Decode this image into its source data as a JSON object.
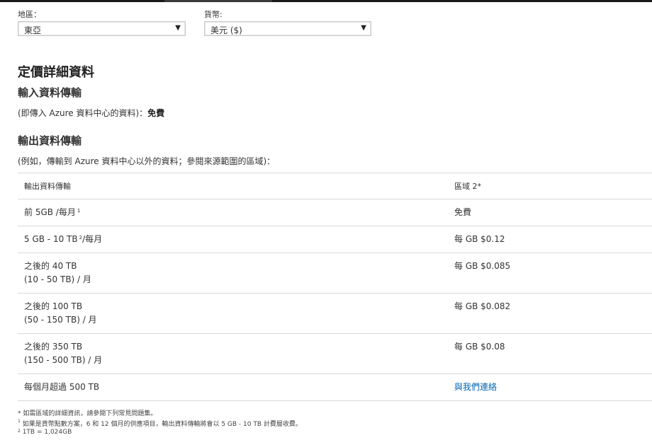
{
  "filters": {
    "region_label": "地區：",
    "region_value": "東亞",
    "currency_label": "貨幣:",
    "currency_value": "美元 ($)"
  },
  "details": {
    "heading": "定價詳細資料",
    "ingress": {
      "heading": "輸入資料傳輸",
      "note_prefix": "(即傳入 Azure 資料中心的資料)：",
      "note_value": "免費"
    },
    "egress": {
      "heading": "輸出資料傳輸",
      "note": "(例如，傳輸到 Azure 資料中心以外的資料；參閱來源範圍的區域)："
    }
  },
  "table": {
    "headers": [
      "輸出資料傳輸",
      "區域 2*"
    ],
    "rows": [
      {
        "tier_line1": "前 5GB /每月",
        "tier_sup": "1",
        "tier_line2": "",
        "price": "免費",
        "link": false
      },
      {
        "tier_line1": "5 GB - 10 TB",
        "tier_sup": "2",
        "tier_suffix": "/每月",
        "tier_line2": "",
        "price": "每 GB $0.12",
        "link": false
      },
      {
        "tier_line1": "之後的 40 TB",
        "tier_line2": "(10 - 50 TB) / 月",
        "price": "每 GB $0.085",
        "link": false
      },
      {
        "tier_line1": "之後的 100 TB",
        "tier_line2": "(50 - 150 TB) / 月",
        "price": "每 GB $0.082",
        "link": false
      },
      {
        "tier_line1": "之後的 350 TB",
        "tier_line2": "(150 - 500 TB) / 月",
        "price": "每 GB $0.08",
        "link": false
      },
      {
        "tier_line1": "每個月超過 500 TB",
        "tier_line2": "",
        "price": "與我們連絡",
        "link": true
      }
    ]
  },
  "footnotes": {
    "star": "* 如需區域的詳細資訊，請參閱下列常見問題集。",
    "one_mark": "1",
    "one": "如果是貨幣點數方案，6 和 12 個月的供應項目，輸出資料傳輸將會以 5 GB - 10 TB 計費層收費。",
    "two_mark": "2",
    "two": "1TB = 1,024GB"
  },
  "colors": {
    "link": "#0066b3",
    "border": "#d9d9d9",
    "topbar": "#1a1a1a"
  }
}
